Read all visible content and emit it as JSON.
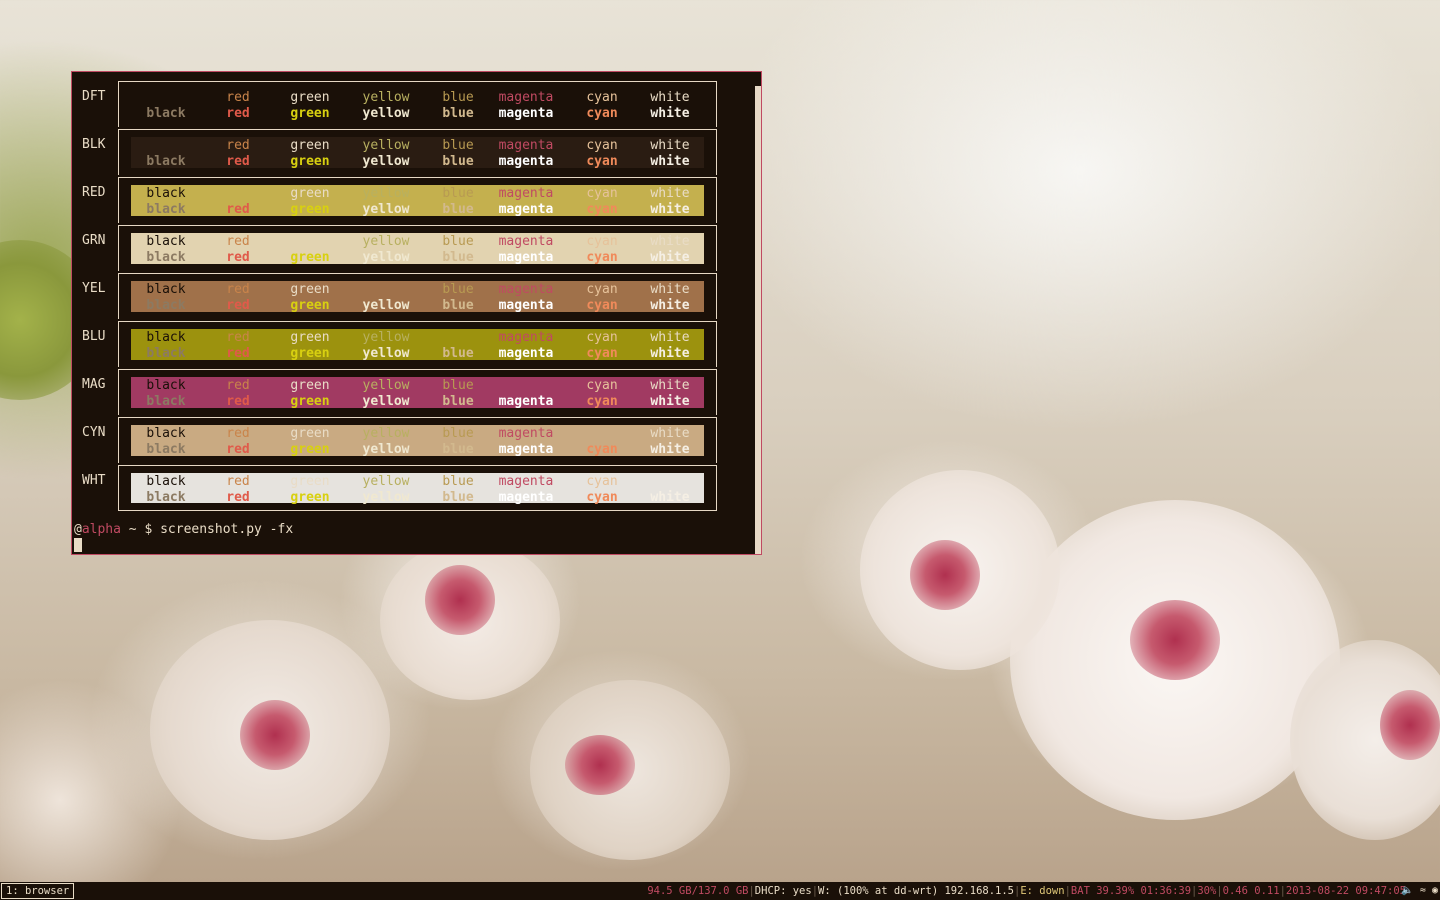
{
  "terminal": {
    "columns": [
      "black",
      "red",
      "green",
      "yellow",
      "blue",
      "magenta",
      "cyan",
      "white"
    ],
    "rows": [
      {
        "label": "DFT",
        "bg": null,
        "top": [
          "",
          "red",
          "green",
          "yellow",
          "blue",
          "magenta",
          "cyan",
          "white"
        ],
        "bottom": [
          "black",
          "red",
          "green",
          "yellow",
          "blue",
          "magenta",
          "cyan",
          "white"
        ]
      },
      {
        "label": "BLK",
        "bg": "#2a1c12",
        "top": [
          "",
          "red",
          "green",
          "yellow",
          "blue",
          "magenta",
          "cyan",
          "white"
        ],
        "bottom": [
          "black",
          "red",
          "green",
          "yellow",
          "blue",
          "magenta",
          "cyan",
          "white"
        ]
      },
      {
        "label": "RED",
        "bg": "#c4b04e",
        "top": [
          "black",
          "",
          "green",
          "yellow",
          "blue",
          "magenta",
          "cyan",
          "white"
        ],
        "bottom": [
          "black",
          "red",
          "green",
          "yellow",
          "blue",
          "magenta",
          "cyan",
          "white"
        ]
      },
      {
        "label": "GRN",
        "bg": "#e2d3b0",
        "top": [
          "black",
          "red",
          "",
          "yellow",
          "blue",
          "magenta",
          "cyan",
          "white"
        ],
        "bottom": [
          "black",
          "red",
          "green",
          "yellow",
          "blue",
          "magenta",
          "cyan",
          "white"
        ]
      },
      {
        "label": "YEL",
        "bg": "#a0714a",
        "top": [
          "black",
          "red",
          "green",
          "",
          "blue",
          "magenta",
          "cyan",
          "white"
        ],
        "bottom": [
          "black",
          "red",
          "green",
          "yellow",
          "blue",
          "magenta",
          "cyan",
          "white"
        ]
      },
      {
        "label": "BLU",
        "bg": "#9c920e",
        "top": [
          "black",
          "red",
          "green",
          "yellow",
          "",
          "magenta",
          "cyan",
          "white"
        ],
        "bottom": [
          "black",
          "red",
          "green",
          "yellow",
          "blue",
          "magenta",
          "cyan",
          "white"
        ]
      },
      {
        "label": "MAG",
        "bg": "#a13a62",
        "top": [
          "black",
          "red",
          "green",
          "yellow",
          "blue",
          "",
          "cyan",
          "white"
        ],
        "bottom": [
          "black",
          "red",
          "green",
          "yellow",
          "blue",
          "magenta",
          "cyan",
          "white"
        ]
      },
      {
        "label": "CYN",
        "bg": "#c9aa82",
        "top": [
          "black",
          "red",
          "green",
          "yellow",
          "blue",
          "magenta",
          "",
          "white"
        ],
        "bottom": [
          "black",
          "red",
          "green",
          "yellow",
          "blue",
          "magenta",
          "cyan",
          "white"
        ]
      },
      {
        "label": "WHT",
        "bg": "#e6e3de",
        "top": [
          "black",
          "red",
          "green",
          "yellow",
          "blue",
          "magenta",
          "cyan",
          ""
        ],
        "bottom": [
          "black",
          "red",
          "green",
          "yellow",
          "blue",
          "magenta",
          "cyan",
          "white"
        ]
      }
    ],
    "fg_normal": {
      "black": "#1a1008",
      "red": "#c9844a",
      "green": "#e9dcc6",
      "yellow": "#b8b060",
      "blue": "#b89a52",
      "magenta": "#c04a62",
      "cyan": "#e6c29a",
      "white": "#e9dcc6"
    },
    "fg_bold": {
      "black": "#8c7a62",
      "red": "#e05a4a",
      "green": "#d8d010",
      "yellow": "#f0e8d0",
      "blue": "#d2b98e",
      "magenta": "#ffffff",
      "cyan": "#f08a5a",
      "white": "#f5efe4"
    },
    "prompt": {
      "user": "@",
      "host": "alpha",
      "rest": " ~ $ screenshot.py -fx"
    }
  },
  "statusbar": {
    "workspace": "1: browser",
    "segments": [
      {
        "text": "94.5 GB/137.0 GB",
        "color": "#c04a62"
      },
      {
        "text": "DHCP: yes",
        "color": "#e9dcc6"
      },
      {
        "text": "W: (100% at dd-wrt) 192.168.1.5",
        "color": "#e9dcc6"
      },
      {
        "text": "E: down",
        "color": "#e0c878"
      },
      {
        "text": "BAT 39.39% 01:36:39",
        "color": "#c04a62"
      },
      {
        "text": "30%",
        "color": "#c04a62"
      },
      {
        "text": "0.46 0.11",
        "color": "#c04a62"
      },
      {
        "text": "2013-08-22 09:47:05",
        "color": "#c04a62"
      }
    ],
    "tray_icons": [
      "volume-icon",
      "wifi-icon",
      "tray-app-icon"
    ]
  }
}
